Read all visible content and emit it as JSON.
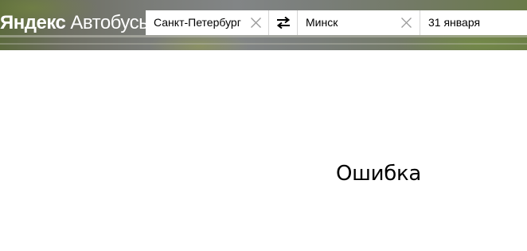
{
  "header": {
    "logo": {
      "brand": "Яндекс",
      "product": "Автобусы"
    },
    "search": {
      "from": {
        "value": "Санкт-Петербург",
        "clear_icon": "close-icon"
      },
      "swap_icon": "swap-arrows-icon",
      "to": {
        "value": "Минск",
        "clear_icon": "close-icon"
      },
      "date": {
        "value": "31 января"
      }
    }
  },
  "main": {
    "error_title": "Ошибка"
  },
  "colors": {
    "text": "#000000",
    "logo_text": "#ffffff",
    "field_bg": "#ffffff",
    "clear_icon": "#999999"
  }
}
